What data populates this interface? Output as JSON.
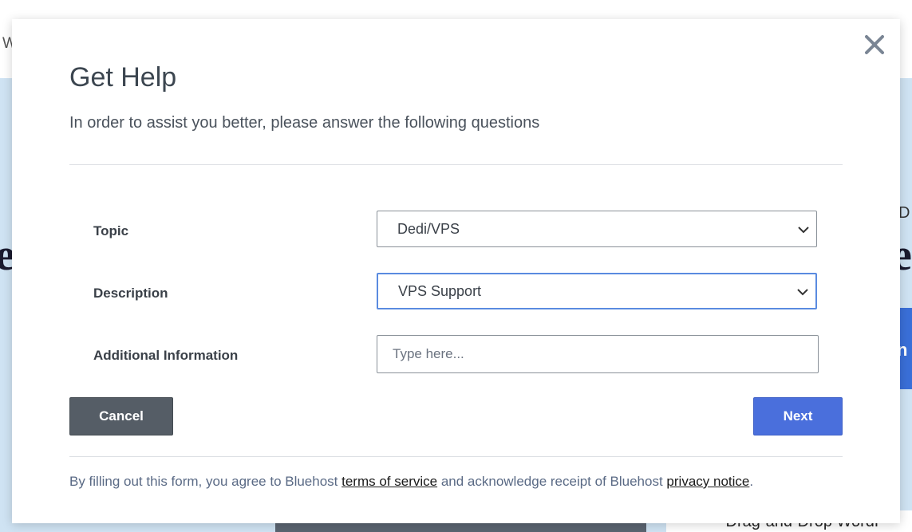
{
  "background": {
    "topbar_char": "W",
    "headline_left_fragment": "e",
    "small_right_fragment": "D",
    "headline_right_fragment": "e",
    "blue_block_fragment": "n",
    "bullet_text_fragment": "• Drag-and-Drop WordP"
  },
  "modal": {
    "close_icon": "close-icon",
    "title": "Get Help",
    "subtitle": "In order to assist you better, please answer the following questions",
    "fields": {
      "topic": {
        "label": "Topic",
        "value": "Dedi/VPS"
      },
      "description": {
        "label": "Description",
        "value": "VPS Support"
      },
      "additional_info": {
        "label": "Additional Information",
        "placeholder": "Type here..."
      }
    },
    "buttons": {
      "cancel": "Cancel",
      "next": "Next"
    },
    "footer": {
      "prefix": "By filling out this form, you agree to Bluehost ",
      "terms_link": "terms of service",
      "middle": " and acknowledge receipt of Bluehost ",
      "privacy_link": "privacy notice",
      "suffix": "."
    }
  },
  "colors": {
    "accent": "#4a6fdc",
    "cancel": "#555d66",
    "focus_border": "#5a8be0",
    "background_band": "#cfe3f3"
  }
}
